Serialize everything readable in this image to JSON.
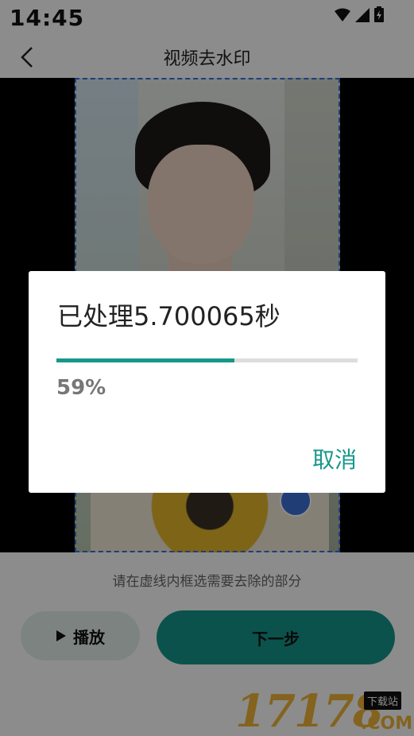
{
  "status_bar": {
    "time": "14:45",
    "icons": [
      "wifi-icon",
      "signal-icon",
      "battery-icon"
    ]
  },
  "app_bar": {
    "back_icon": "chevron-left-icon",
    "title": "视频去水印"
  },
  "editor": {
    "hint": "请在虚线内框选需要去除的部分",
    "play_label": "播放",
    "next_label": "下一步"
  },
  "dialog": {
    "title": "已处理5.700065秒",
    "progress": 0.59,
    "percent_text": "59%",
    "cancel_label": "取消"
  },
  "watermark": {
    "number": "17178",
    "tag": "下载站",
    "domain": ".COM"
  },
  "colors": {
    "accent": "#16978a",
    "selection": "#3b6fd8"
  }
}
